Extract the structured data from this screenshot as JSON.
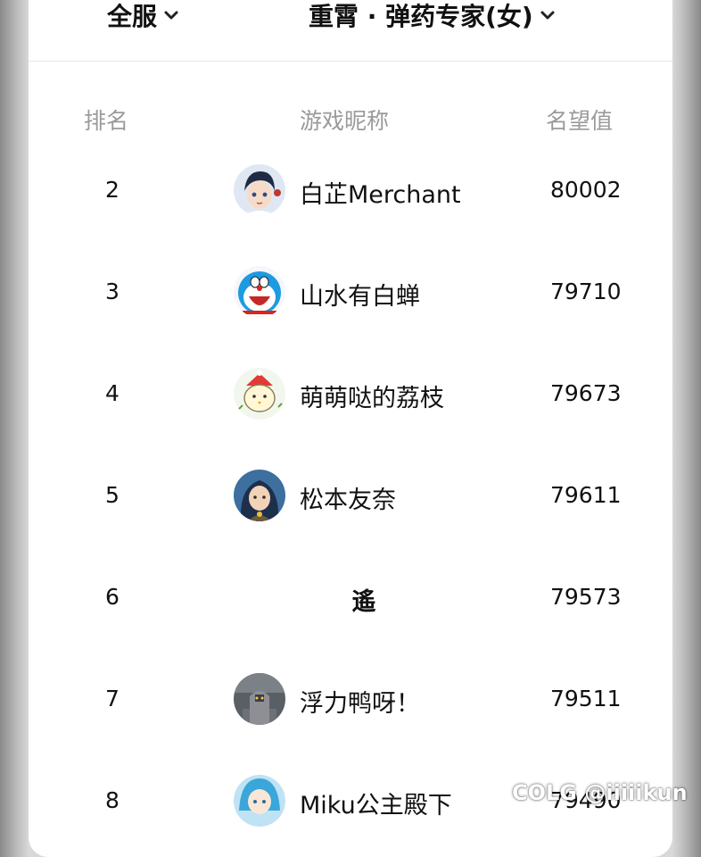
{
  "filters": {
    "server": "全服",
    "class": "重霄 · 弹药专家(女)"
  },
  "table": {
    "columns": [
      "排名",
      "游戏昵称",
      "名望值"
    ],
    "rows": [
      {
        "rank": "2",
        "nickname": "白芷Merchant",
        "value": "80002",
        "avatar": "anime-boy-avatar"
      },
      {
        "rank": "3",
        "nickname": "山水有白蝉",
        "value": "79710",
        "avatar": "doraemon-avatar"
      },
      {
        "rank": "4",
        "nickname": "萌萌哒的荔枝",
        "value": "79673",
        "avatar": "cartoon-chick-avatar"
      },
      {
        "rank": "5",
        "nickname": "松本友奈",
        "value": "79611",
        "avatar": "anime-girl-avatar"
      },
      {
        "rank": "6",
        "nickname": "遙",
        "value": "79573",
        "avatar": ""
      },
      {
        "rank": "7",
        "nickname": "浮力鸭呀！",
        "value": "79511",
        "avatar": "armor-figure-avatar"
      },
      {
        "rank": "8",
        "nickname": "Miku公主殿下",
        "value": "79490",
        "avatar": "blue-hair-avatar"
      }
    ]
  },
  "watermark": "COLG @iiiiikun",
  "colors": {
    "text": "#111111",
    "header_text": "#9a9a9a",
    "card": "#ffffff"
  }
}
